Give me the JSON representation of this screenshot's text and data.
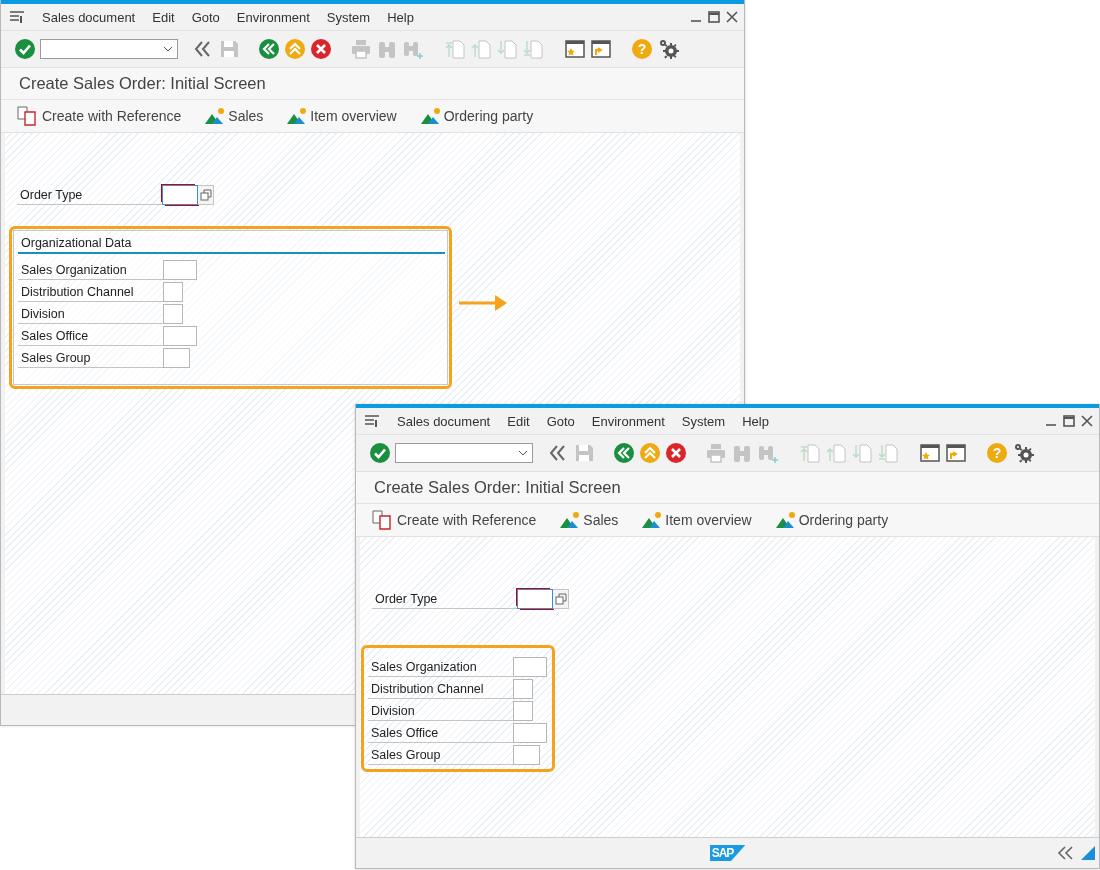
{
  "windows": [
    {
      "menu": [
        "Sales document",
        "Edit",
        "Goto",
        "Environment",
        "System",
        "Help"
      ],
      "toolbar": [
        {
          "kind": "enter",
          "disabled": false
        },
        {
          "kind": "command",
          "disabled": false
        },
        {
          "kind": "collapse",
          "disabled": false
        },
        {
          "kind": "save",
          "disabled": true
        },
        {
          "kind": "back",
          "disabled": false
        },
        {
          "kind": "exit",
          "disabled": false
        },
        {
          "kind": "cancel",
          "disabled": false
        },
        {
          "kind": "print",
          "disabled": true
        },
        {
          "kind": "find",
          "disabled": true
        },
        {
          "kind": "find_next",
          "disabled": true
        },
        {
          "kind": "first_page",
          "disabled": true
        },
        {
          "kind": "previous_page",
          "disabled": true
        },
        {
          "kind": "next_page",
          "disabled": true
        },
        {
          "kind": "last_page",
          "disabled": true
        },
        {
          "kind": "new_session",
          "disabled": false
        },
        {
          "kind": "shortcut",
          "disabled": false
        },
        {
          "kind": "help",
          "disabled": false,
          "glyph": "?"
        },
        {
          "kind": "settings",
          "disabled": false
        }
      ],
      "title": "Create Sales Order: Initial Screen",
      "app_toolbar": [
        {
          "kind": "reference",
          "label": "Create with Reference"
        },
        {
          "kind": "navigate",
          "label": "Sales"
        },
        {
          "kind": "navigate",
          "label": "Item overview"
        },
        {
          "kind": "navigate",
          "label": "Ordering party"
        }
      ],
      "order_type": {
        "label": "Order Type",
        "focused": true
      },
      "org_data": {
        "title": "Organizational Data",
        "highlighted": true,
        "fields": [
          "Sales Organization",
          "Distribution Channel",
          "Division",
          "Sales Office",
          "Sales Group"
        ]
      }
    },
    {
      "menu": [
        "Sales document",
        "Edit",
        "Goto",
        "Environment",
        "System",
        "Help"
      ],
      "toolbar": [
        {
          "kind": "enter",
          "disabled": false
        },
        {
          "kind": "command",
          "disabled": false
        },
        {
          "kind": "collapse",
          "disabled": false
        },
        {
          "kind": "save",
          "disabled": true
        },
        {
          "kind": "back",
          "disabled": false
        },
        {
          "kind": "exit",
          "disabled": false
        },
        {
          "kind": "cancel",
          "disabled": false
        },
        {
          "kind": "print",
          "disabled": true
        },
        {
          "kind": "find",
          "disabled": true
        },
        {
          "kind": "find_next",
          "disabled": true
        },
        {
          "kind": "first_page",
          "disabled": true
        },
        {
          "kind": "previous_page",
          "disabled": true
        },
        {
          "kind": "next_page",
          "disabled": true
        },
        {
          "kind": "last_page",
          "disabled": true
        },
        {
          "kind": "new_session",
          "disabled": false
        },
        {
          "kind": "shortcut",
          "disabled": false
        },
        {
          "kind": "help",
          "disabled": false,
          "glyph": "?"
        },
        {
          "kind": "settings",
          "disabled": false
        }
      ],
      "title": "Create Sales Order: Initial Screen",
      "app_toolbar": [
        {
          "kind": "reference",
          "label": "Create with Reference"
        },
        {
          "kind": "navigate",
          "label": "Sales"
        },
        {
          "kind": "navigate",
          "label": "Item overview"
        },
        {
          "kind": "navigate",
          "label": "Ordering party"
        }
      ],
      "order_type": {
        "label": "Order Type",
        "focused": true
      },
      "org_data": {
        "highlighted": true,
        "fields": [
          "Sales Organization",
          "Distribution Channel",
          "Division",
          "Sales Office",
          "Sales Group"
        ]
      },
      "status_bar": {
        "logo": "SAP"
      }
    }
  ],
  "annotation_arrow": true
}
